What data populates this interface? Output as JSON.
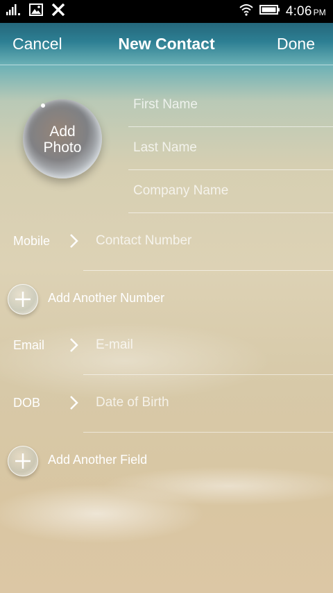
{
  "status_bar": {
    "time": "4:06",
    "ampm": "PM",
    "icons": [
      "signal-icon",
      "image-icon",
      "x-icon",
      "wifi-icon",
      "battery-icon"
    ]
  },
  "header": {
    "cancel_label": "Cancel",
    "title": "New Contact",
    "done_label": "Done"
  },
  "photo": {
    "label_line1": "Add",
    "label_line2": "Photo"
  },
  "name_fields": {
    "first_name_placeholder": "First Name",
    "last_name_placeholder": "Last Name",
    "company_placeholder": "Company Name"
  },
  "fields": [
    {
      "label": "Mobile",
      "placeholder": "Contact Number"
    },
    {
      "label": "Email",
      "placeholder": "E-mail"
    },
    {
      "label": "DOB",
      "placeholder": "Date of Birth"
    }
  ],
  "actions": {
    "add_number": "Add Another Number",
    "add_field": "Add Another Field"
  },
  "colors": {
    "text": "#ffffff",
    "status_bar_bg": "#000000"
  }
}
